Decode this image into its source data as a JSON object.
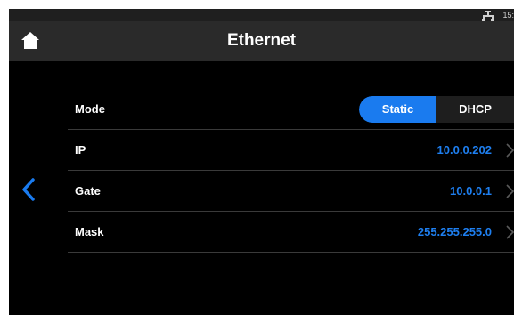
{
  "status_bar": {
    "icon": "ethernet-status-icon",
    "time": "15:"
  },
  "header": {
    "title": "Ethernet",
    "home_icon": "home-icon"
  },
  "nav": {
    "back_icon": "chevron-left-icon"
  },
  "colors": {
    "accent": "#1a7bef",
    "value_text": "#1e7ff0",
    "background": "#000000",
    "header_bg": "#2a2a2a"
  },
  "settings": {
    "mode": {
      "label": "Mode",
      "options": [
        "Static",
        "DHCP"
      ],
      "selected": "Static"
    },
    "rows": [
      {
        "label": "IP",
        "value": "10.0.0.202"
      },
      {
        "label": "Gate",
        "value": "10.0.0.1"
      },
      {
        "label": "Mask",
        "value": "255.255.255.0"
      }
    ]
  }
}
